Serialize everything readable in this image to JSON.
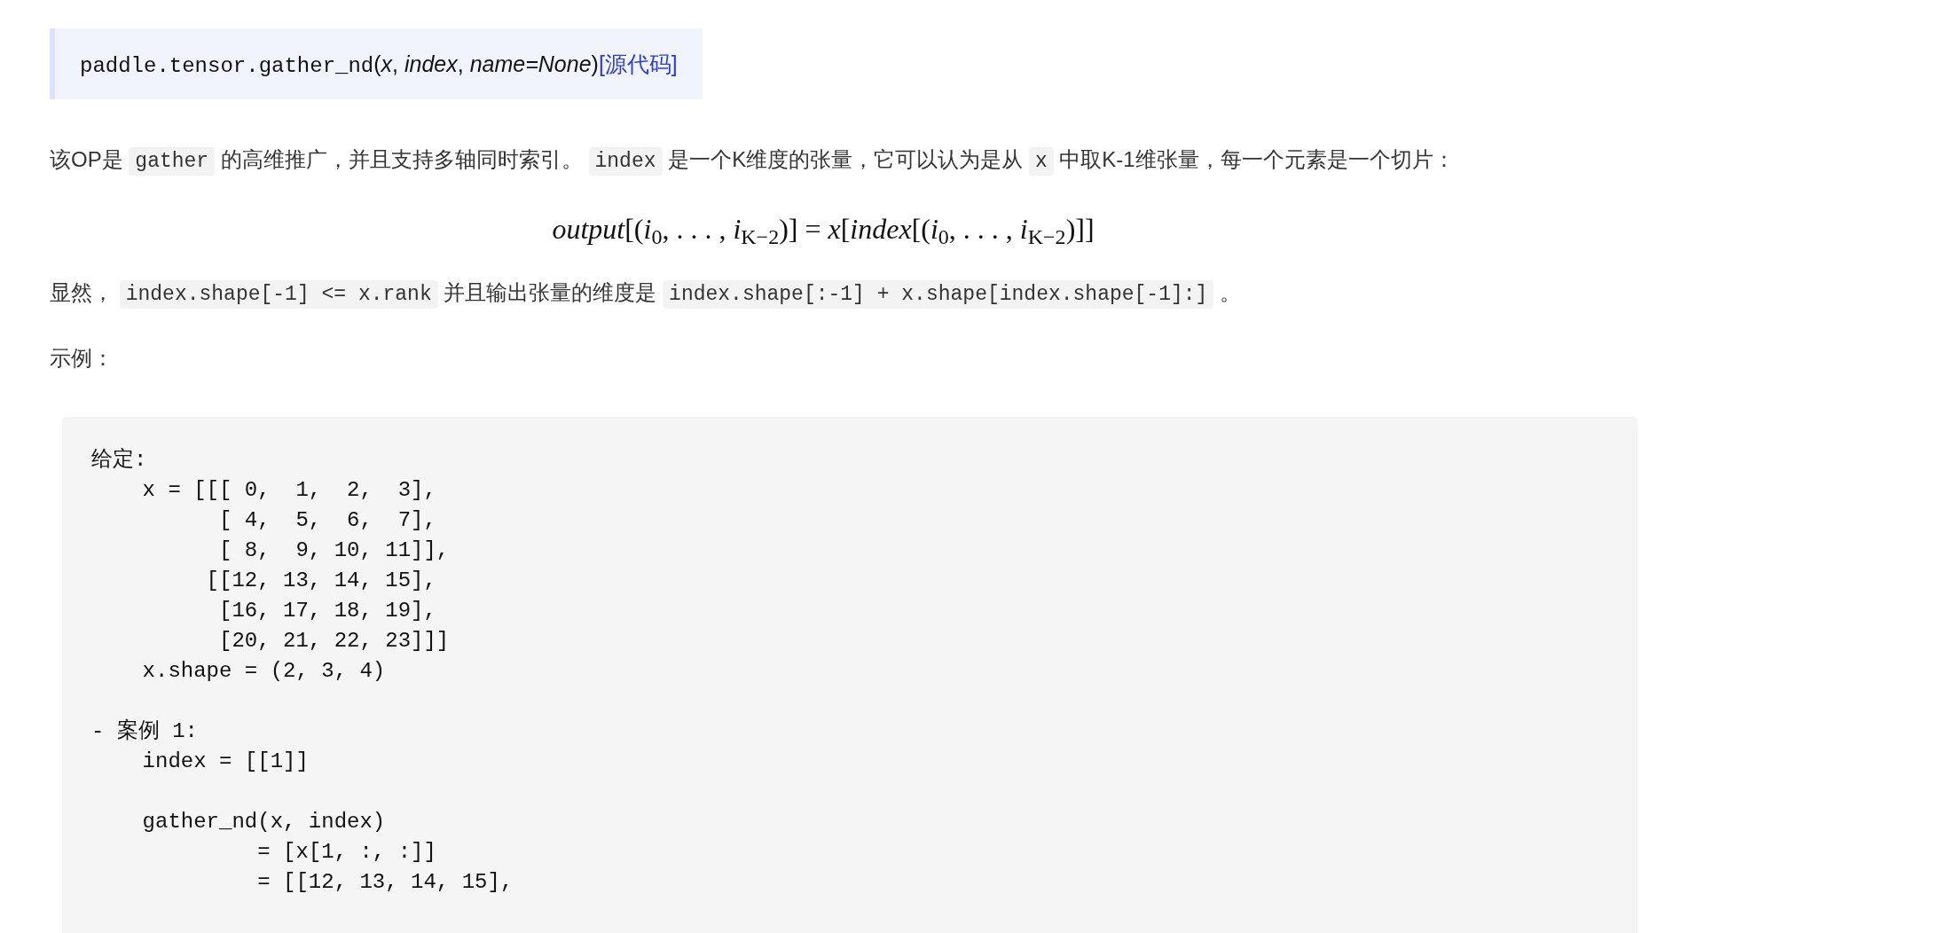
{
  "signature": [
    {
      "kind": "mono",
      "text": "paddle.tensor.gather_nd"
    },
    {
      "kind": "plain",
      "text": "("
    },
    {
      "kind": "param",
      "text": "x"
    },
    {
      "kind": "plain",
      "text": ", "
    },
    {
      "kind": "param",
      "text": "index"
    },
    {
      "kind": "plain",
      "text": ", "
    },
    {
      "kind": "param",
      "text": "name=None"
    },
    {
      "kind": "plain",
      "text": ")"
    },
    {
      "kind": "link",
      "text": "[源代码]"
    }
  ],
  "paragraphs": [
    {
      "kind": "text",
      "segments": [
        {
          "kind": "text",
          "text": "该OP是 "
        },
        {
          "kind": "code",
          "text": "gather"
        },
        {
          "kind": "text",
          "text": " 的高维推广，并且支持多轴同时索引。 "
        },
        {
          "kind": "code",
          "text": "index"
        },
        {
          "kind": "text",
          "text": " 是一个K维度的张量，它可以认为是从 "
        },
        {
          "kind": "code",
          "text": "x"
        },
        {
          "kind": "text",
          "text": " 中取K-1维张量，每一个元素是一个切片："
        }
      ]
    },
    {
      "kind": "formula",
      "text": "*output*[(*i*$_{0}$, . . . , *i*$_{K−2}$)] = *x*[*index*[(*i*$_{0}$, . . . , *i*$_{K−2}$)]]"
    },
    {
      "kind": "text",
      "segments": [
        {
          "kind": "text",
          "text": "显然， "
        },
        {
          "kind": "code",
          "text": "index.shape[-1] <= x.rank"
        },
        {
          "kind": "text",
          "text": " 并且输出张量的维度是 "
        },
        {
          "kind": "code",
          "text": "index.shape[:-1] + x.shape[index.shape[-1]:]"
        },
        {
          "kind": "text",
          "text": " 。"
        }
      ]
    },
    {
      "kind": "text",
      "segments": [
        {
          "kind": "text",
          "text": "示例："
        }
      ]
    }
  ],
  "code_block": [
    [
      "给定:",
      "    x = [[[ 0,  1,  2,  3],",
      "          [ 4,  5,  6,  7],",
      "          [ 8,  9, 10, 11]],",
      "         [[12, 13, 14, 15],",
      "          [16, 17, 18, 19],",
      "          [20, 21, 22, 23]]]",
      "    x.shape = (2, 3, 4)"
    ],
    [
      "- 案例 1:",
      "    index = [[1]]"
    ],
    [
      "    gather_nd(x, index)",
      "             = [x[1, :, :]]",
      "             = [[12, 13, 14, 15],"
    ]
  ]
}
